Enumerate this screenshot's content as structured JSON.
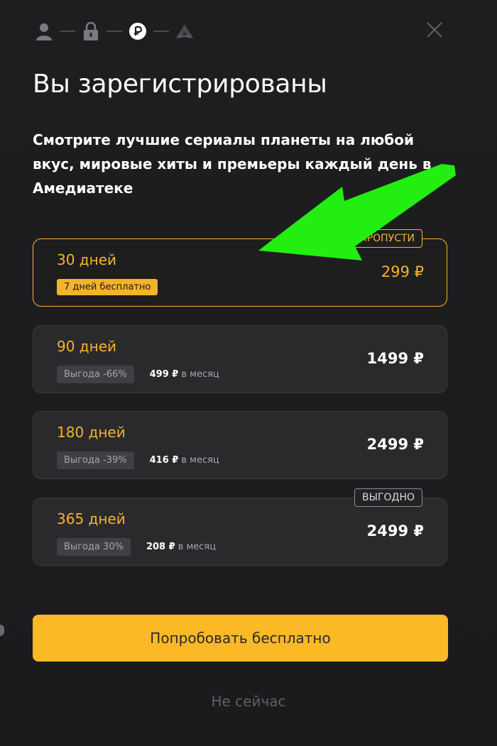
{
  "header": {
    "steps": [
      {
        "icon": "user-icon",
        "state": "done"
      },
      {
        "icon": "lock-icon",
        "state": "done"
      },
      {
        "icon": "ruble-icon",
        "state": "active"
      },
      {
        "icon": "amediateka-logo-icon",
        "state": "pending"
      }
    ],
    "close_icon": "close-icon"
  },
  "title": "Вы зарегистрированы",
  "subtitle": "Смотрите лучшие сериалы планеты на любой вкус, мировые хиты и премьеры каждый день в Амедиатеке",
  "plans": [
    {
      "name": "30 дней",
      "price": "299 ₽",
      "badge": "7 дней бесплатно",
      "tag": "ПРОПУСТИ",
      "selected": true
    },
    {
      "name": "90 дней",
      "price": "1499 ₽",
      "discount": "Выгода -66%",
      "monthly_price": "499 ₽",
      "monthly_unit": "в месяц"
    },
    {
      "name": "180 дней",
      "price": "2499 ₽",
      "discount": "Выгода -39%",
      "monthly_price": "416 ₽",
      "monthly_unit": "в месяц"
    },
    {
      "name": "365 дней",
      "price": "2499 ₽",
      "discount": "Выгода 30%",
      "monthly_price": "208 ₽",
      "monthly_unit": "в месяц",
      "tag": "ВЫГОДНО"
    }
  ],
  "cta_label": "Попробовать бесплатно",
  "secondary_label": "Не сейчас",
  "colors": {
    "accent": "#f5b32c",
    "button": "#fbb926",
    "background": "#1c1c1e",
    "card": "#2a2a2d",
    "annotation_arrow": "#22ee11"
  }
}
